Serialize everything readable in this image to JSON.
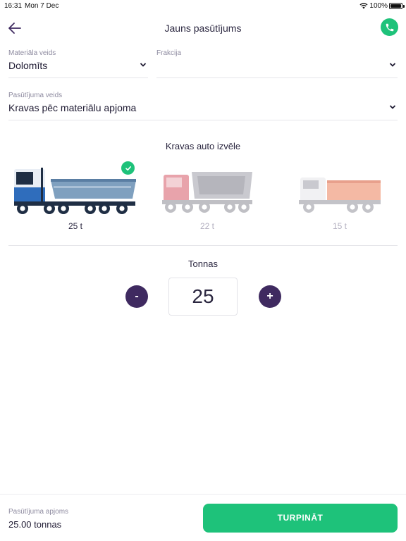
{
  "status_bar": {
    "time": "16:31",
    "date": "Mon 7 Dec",
    "battery": "100%"
  },
  "nav": {
    "title": "Jauns pasūtījums"
  },
  "fields": {
    "material": {
      "label": "Materiāla veids",
      "value": "Dolomīts"
    },
    "fraction": {
      "label": "Frakcija",
      "value": ""
    },
    "order_type": {
      "label": "Pasūtījuma veids",
      "value": "Kravas pēc materiālu apjoma"
    }
  },
  "truck_section": {
    "title": "Kravas auto izvēle",
    "selected_index": 0,
    "trucks": [
      {
        "label": "25 t",
        "cab": "#e9eef5",
        "stripe": "#2f6dbc",
        "body": "#7fa0bf",
        "chassis": "#1f2e44"
      },
      {
        "label": "22 t",
        "cab": "#e8a3ab",
        "stripe": "#e8a3ab",
        "body": "#c9c9cf",
        "chassis": "#bfbfc4"
      },
      {
        "label": "15 t",
        "cab": "#f1f1f3",
        "stripe": "#f1f1f3",
        "body": "#f4b9a4",
        "chassis": "#c3c3c8"
      }
    ]
  },
  "tonnage": {
    "title": "Tonnas",
    "minus": "-",
    "value": "25",
    "plus": "+"
  },
  "footer": {
    "label": "Pasūtījuma apjoms",
    "value": "25.00 tonnas",
    "button": "TURPINĀT"
  },
  "colors": {
    "accent": "#1ec27a",
    "stepper": "#3f2a60",
    "text": "#2b2740",
    "muted": "#8e8ba0"
  }
}
